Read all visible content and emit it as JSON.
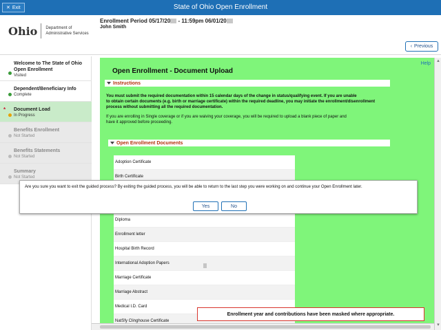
{
  "banner": {
    "exit_label": "Exit",
    "title": "State of Ohio Open Enrollment"
  },
  "header": {
    "logo_text": "Ohio",
    "dept_line1": "Department of",
    "dept_line2": "Administrative Services",
    "period_prefix": "Enrollment Period 05/17/20",
    "period_middle": " - 11:59pm 06/01/20",
    "employee_name": "John Smith",
    "previous_label": "Previous"
  },
  "sidebar": {
    "steps": [
      {
        "title_line1": "Welcome to The State of Ohio",
        "title_line2": "Open Enrollment",
        "status": "Visited",
        "state": "complete"
      },
      {
        "title_line1": "Dependent/Beneficiary Info",
        "title_line2": "",
        "status": "Complete",
        "state": "complete"
      },
      {
        "title_line1": "Document Load",
        "title_line2": "",
        "status": "In Progress",
        "state": "active"
      },
      {
        "title_line1": "Benefits Enrollment",
        "title_line2": "",
        "status": "Not Started",
        "state": "disabled"
      },
      {
        "title_line1": "Benefits Statements",
        "title_line2": "",
        "status": "Not Started",
        "state": "disabled"
      },
      {
        "title_line1": "Summary",
        "title_line2": "",
        "status": "Not Started",
        "state": "disabled"
      }
    ],
    "active_marker": "*"
  },
  "main": {
    "help_label": "Help",
    "title": "Open Enrollment - Document Upload",
    "instructions_label": "Instructions",
    "instr_bold_1": "You must submit the required documentation within 15 calendar days of the change in status/qualifying event. If you are unable",
    "instr_bold_2": "to obtain certain documents (e.g. birth or marriage certificate) within the required deadline, you may initiate the enrollment/disenrollment",
    "instr_bold_3": "process without submitting all the required documentation.",
    "instr_2a": "If you are enrolling in Single coverage or if you are waiving your coverage, you will be required to upload a blank piece of paper and",
    "instr_2b": "have it approved before proceeding.",
    "documents_label": "Open Enrollment Documents",
    "documents": [
      "Adoption Certificate",
      "Birth Certificate",
      "",
      "",
      "Diploma",
      "Enrollment letter",
      "Hospital Birth Record",
      "International Adoption Papers",
      "Marriage Certificate",
      "Marriage Abstract",
      "Medical I.D. Card",
      "NatSfy Clinghouse Certificate"
    ]
  },
  "dialog": {
    "message": "Are you sure you want to exit the guided process? By exiting the guided process, you will be able to return to the last step you were working on and continue your Open Enrollment later.",
    "yes_label": "Yes",
    "no_label": "No"
  },
  "mask_note": "Enrollment year and contributions have been masked where appropriate.",
  "colors": {
    "banner": "#1e6fb5",
    "main_bg": "#7ff57a",
    "section_label": "#b3300a",
    "active_step": "#c9ebc9"
  }
}
